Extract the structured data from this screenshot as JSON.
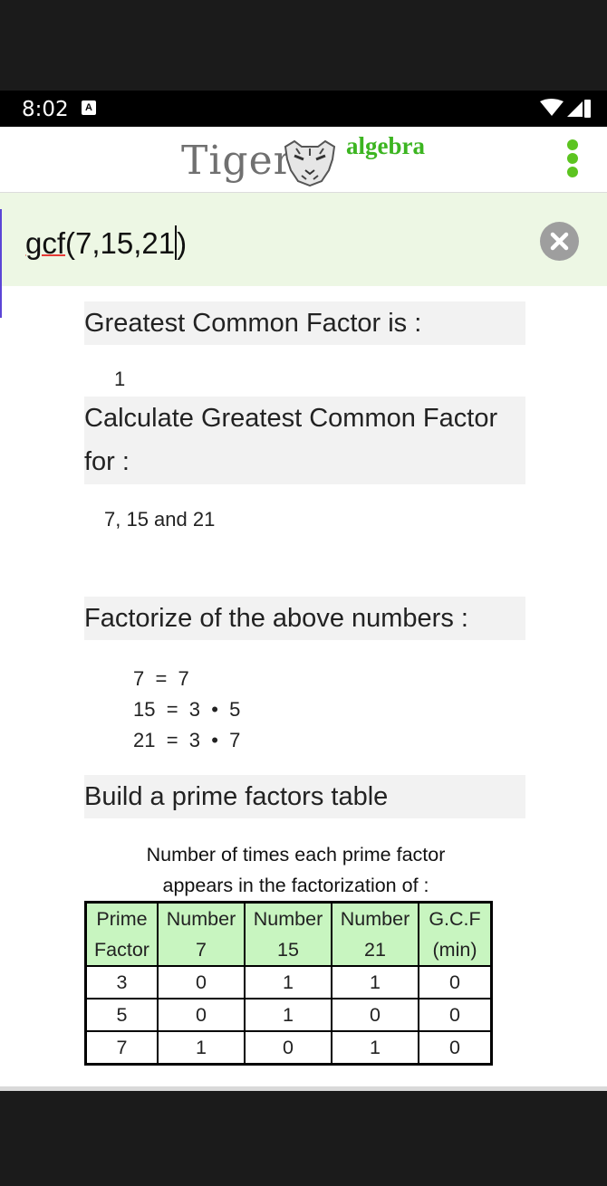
{
  "status_bar": {
    "time": "8:02",
    "notification_badge": "A"
  },
  "header": {
    "logo_word": "Tiger",
    "logo_sub": "algebra"
  },
  "input": {
    "query_underlined": "gcf",
    "query_rest": "(7,15,21",
    "query_after_cursor": ")"
  },
  "result": {
    "heading": "Greatest Common Factor is :",
    "value": "1"
  },
  "calculate": {
    "heading": "Calculate Greatest Common Factor for :",
    "value": "7, 15 and 21"
  },
  "factorize": {
    "heading": "Factorize of the above numbers :",
    "rows": [
      "7  =  7",
      "15  =  3  •  5",
      "21  =  3  •  7"
    ]
  },
  "prime_table": {
    "heading": "Build a prime factors table",
    "caption_line1": "Number of times each prime factor",
    "caption_line2": "appears in the factorization of :",
    "columns": [
      {
        "line1": "Prime",
        "line2": "Factor"
      },
      {
        "line1": "Number",
        "line2": "7"
      },
      {
        "line1": "Number",
        "line2": "15"
      },
      {
        "line1": "Number",
        "line2": "21"
      },
      {
        "line1": "G.C.F",
        "line2": "(min)"
      }
    ],
    "rows": [
      [
        "3",
        "0",
        "1",
        "1",
        "0"
      ],
      [
        "5",
        "0",
        "1",
        "0",
        "0"
      ],
      [
        "7",
        "1",
        "0",
        "1",
        "0"
      ]
    ]
  },
  "colors": {
    "brand_green": "#5cc420",
    "input_bg": "#edf7e4",
    "table_header_bg": "#c8f5c0"
  }
}
